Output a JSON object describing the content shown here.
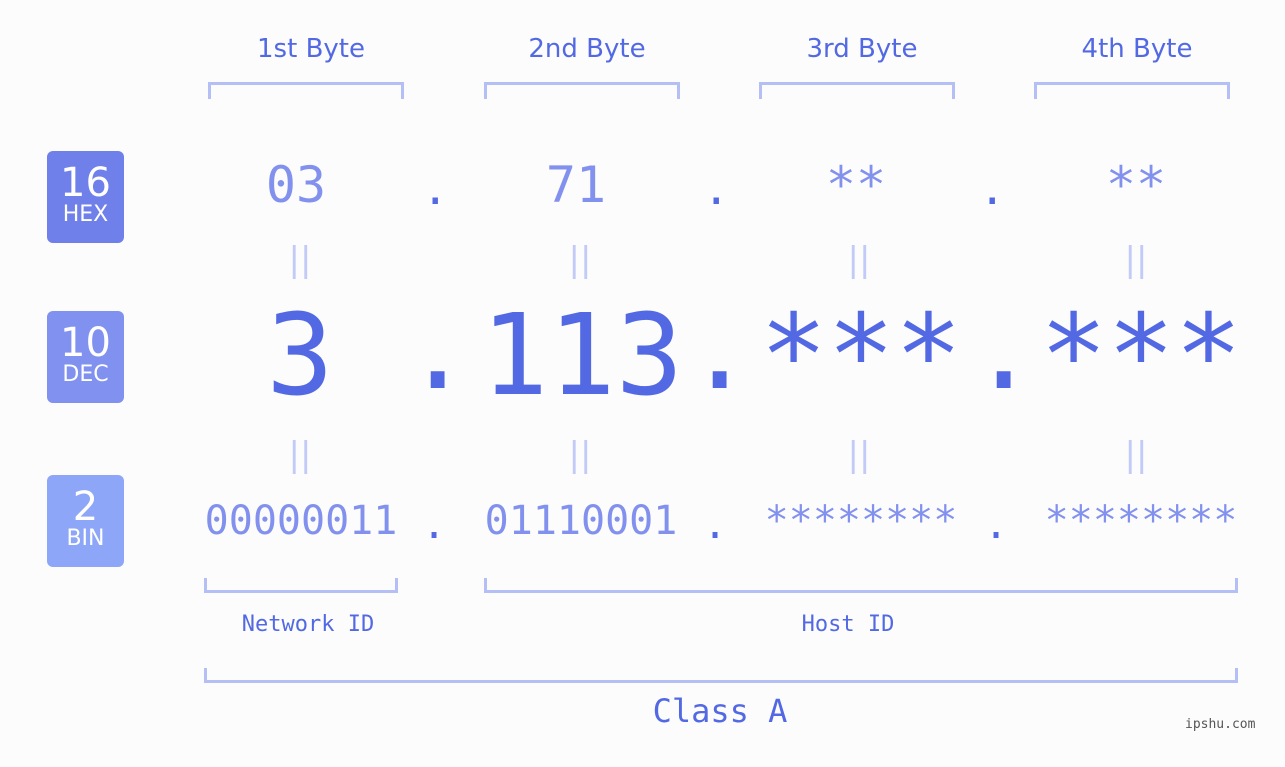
{
  "badges": [
    {
      "number": "16",
      "label": "HEX",
      "color": "#7080ea"
    },
    {
      "number": "10",
      "label": "DEC",
      "color": "#8191f0"
    },
    {
      "number": "2",
      "label": "BIN",
      "color": "#8ea6f7"
    }
  ],
  "byte_headers": [
    "1st Byte",
    "2nd Byte",
    "3rd Byte",
    "4th Byte"
  ],
  "hex": [
    "03",
    "71",
    "**",
    "**"
  ],
  "dec": [
    "3",
    "113",
    "***",
    "***"
  ],
  "bin": [
    "00000011",
    "01110001",
    "********",
    "********"
  ],
  "separator": ".",
  "equals": "||",
  "network_label": "Network ID",
  "host_label": "Host ID",
  "class_label": "Class A",
  "watermark": "ipshu.com",
  "colors": {
    "accent": "#5369e3",
    "light_text": "#8391ee",
    "bracket": "#b4bff6",
    "background": "#fbfcfb"
  }
}
